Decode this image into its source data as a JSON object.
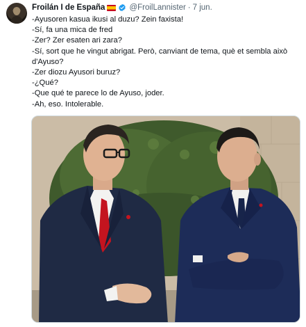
{
  "tweet": {
    "author": {
      "display_name": "Froilán I de España",
      "handle": "@FroilLannister",
      "flag_icon": "spain-flag-icon",
      "verified_icon": "verified-badge-icon",
      "verified_color": "#1d9bf0"
    },
    "separator": "·",
    "date": "7 jun.",
    "lines": [
      "-Ayusoren kasua ikusi al duzu? Zein faxista!",
      "-Sí, fa una mica de fred",
      "-Zer? Zer esaten ari zara?",
      "-Sí, sort que he vingut abrigat. Però, canviant de tema, què et sembla això",
      "d'Ayuso?",
      "-Zer diozu Ayusori buruz?",
      "-¿Qué?",
      "-Que qué te parece lo de Ayuso, joder.",
      "-Ah, eso. Intolerable."
    ]
  }
}
